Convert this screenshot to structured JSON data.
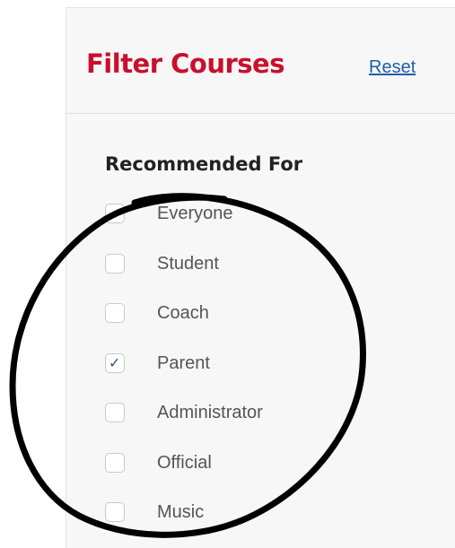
{
  "panel": {
    "title": "Filter Courses",
    "reset_label": "Reset"
  },
  "section": {
    "title": "Recommended For",
    "options": [
      {
        "label": "Everyone",
        "checked": false
      },
      {
        "label": "Student",
        "checked": false
      },
      {
        "label": "Coach",
        "checked": false
      },
      {
        "label": "Parent",
        "checked": true
      },
      {
        "label": "Administrator",
        "checked": false
      },
      {
        "label": "Official",
        "checked": false
      },
      {
        "label": "Music",
        "checked": false
      }
    ]
  },
  "colors": {
    "title_red": "#c8102e",
    "link_blue": "#1f5fa8",
    "panel_bg": "#f7f7f7",
    "check_mark": "#2c4f86",
    "annotation_ink": "#000000"
  },
  "icons": {
    "check": "✓"
  }
}
